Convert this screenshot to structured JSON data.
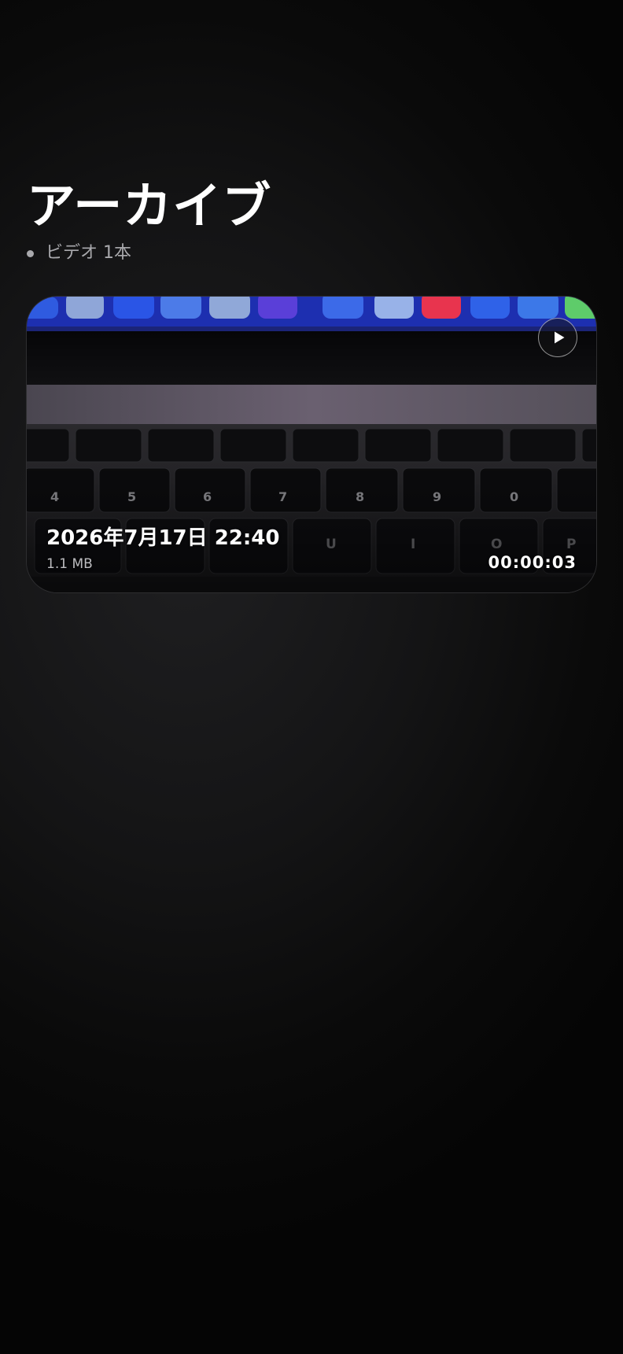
{
  "page": {
    "title": "アーカイブ",
    "video_count_label": "ビデオ 1本"
  },
  "videos": [
    {
      "date": "2026年7月17日 22:40",
      "size": "1.1 MB",
      "duration": "00:00:03",
      "thumbnail_description_icon": "keyboard-photo",
      "play_icon": "play-icon"
    }
  ],
  "colors": {
    "background": "#0c0c0d",
    "title": "#ffffff",
    "subtitle": "#a9a9ad",
    "card_border": "#2a2a2c",
    "dock_blue": "#2f5be0",
    "music_red": "#e8344e"
  }
}
